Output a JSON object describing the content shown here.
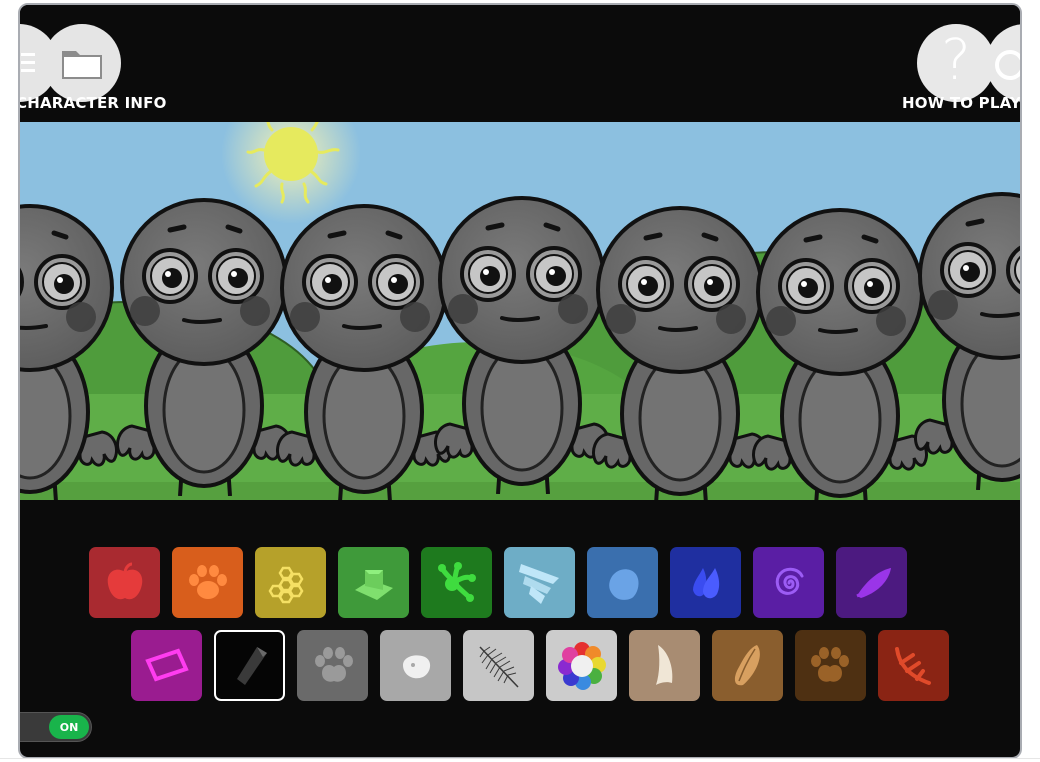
{
  "header": {
    "character_info_label": "CHARACTER INFO",
    "how_to_play_label": "HOW TO PLAY",
    "how_to_play_glyph": "?"
  },
  "scene": {
    "sky_color": "#8cc0e0",
    "hill_color": "#4f9c3c",
    "grass_color": "#5fae48",
    "sun_color": "#e6ea5e",
    "character_color": "#6c6c6c"
  },
  "palette": {
    "row1": [
      {
        "name": "apple",
        "color": "#a92a30"
      },
      {
        "name": "paw",
        "color": "#d85e1c"
      },
      {
        "name": "honeycomb",
        "color": "#b6a12a"
      },
      {
        "name": "hat",
        "color": "#3f9a3a"
      },
      {
        "name": "frog-hand",
        "color": "#1e7a1e"
      },
      {
        "name": "striped-tail",
        "color": "#6eadc6"
      },
      {
        "name": "blob",
        "color": "#3a6fae"
      },
      {
        "name": "drops",
        "color": "#1f2fa0"
      },
      {
        "name": "spiral",
        "color": "#5a1ea4"
      },
      {
        "name": "feather",
        "color": "#4c1a80"
      }
    ],
    "row2": [
      {
        "name": "crystal-slab",
        "color": "#9a1c90"
      },
      {
        "name": "black-crystal",
        "color": "#050505"
      },
      {
        "name": "gray-paw",
        "color": "#6a6a6a"
      },
      {
        "name": "white-blob",
        "color": "#a8a8a8"
      },
      {
        "name": "fern",
        "color": "#c6c6c6"
      },
      {
        "name": "rainbow-flower",
        "color": "#cccccc"
      },
      {
        "name": "horn",
        "color": "#a88c72"
      },
      {
        "name": "seed",
        "color": "#8a5e2e"
      },
      {
        "name": "brown-paw",
        "color": "#4e3012"
      },
      {
        "name": "antler",
        "color": "#8a2414"
      }
    ]
  },
  "toggle": {
    "label": "ON"
  }
}
